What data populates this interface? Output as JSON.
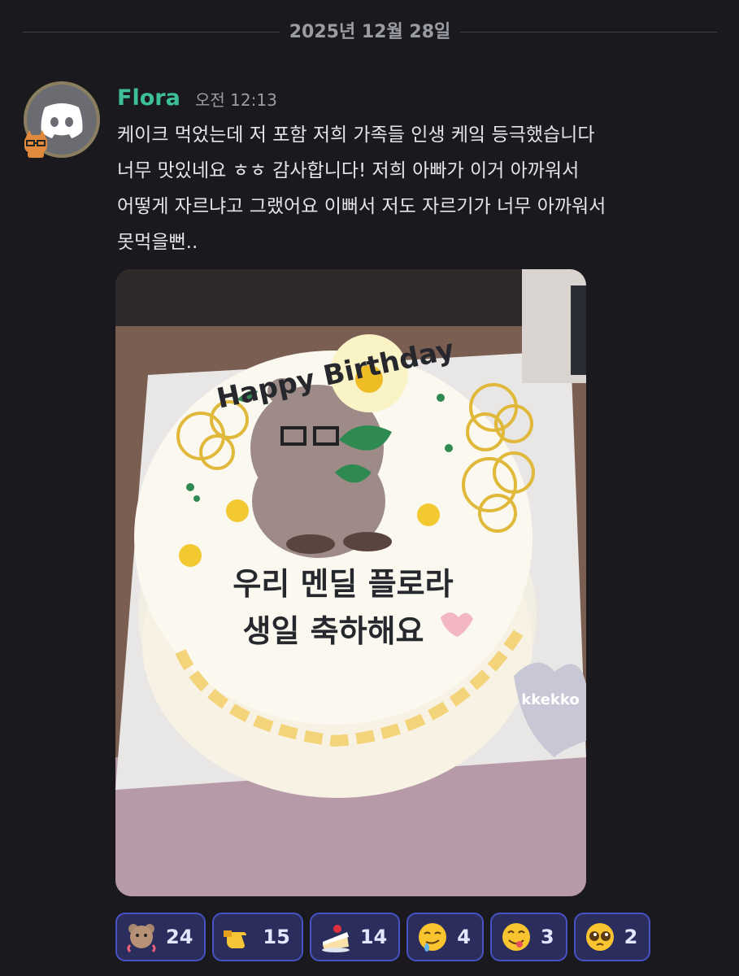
{
  "date_divider": "2025년 12월 28일",
  "message": {
    "author": "Flora",
    "author_color": "#3dbf9a",
    "timestamp": "오전 12:13",
    "text": "케이크 먹었는데 저 포함 저희 가족들 인생 케잌 등극했습니다\n너무 맛있네요 ㅎㅎ 감사합니다! 저희 아빠가 이거 아까워서\n어떻게 자르냐고 그랬어요 이뻐서 저도 자르기가 너무 아까워서\n못먹을뻔.."
  },
  "attachment": {
    "cake_top_text": "Happy Birthday",
    "cake_line1": "우리 멘딜 플로라",
    "cake_line2": "생일 축하해요",
    "box_label": "kkekko"
  },
  "reactions": [
    {
      "icon": "bear-hug-emoji",
      "count": "24"
    },
    {
      "icon": "pointing-hand-emoji",
      "count": "15"
    },
    {
      "icon": "cake-slice-emoji",
      "count": "14"
    },
    {
      "icon": "drooling-face-emoji",
      "count": "4"
    },
    {
      "icon": "yum-face-emoji",
      "count": "3"
    },
    {
      "icon": "pleading-face-emoji",
      "count": "2"
    }
  ],
  "colors": {
    "background": "#1a1a1e",
    "reaction_border": "#4752c4",
    "reaction_bg": "#2b2e5c"
  }
}
